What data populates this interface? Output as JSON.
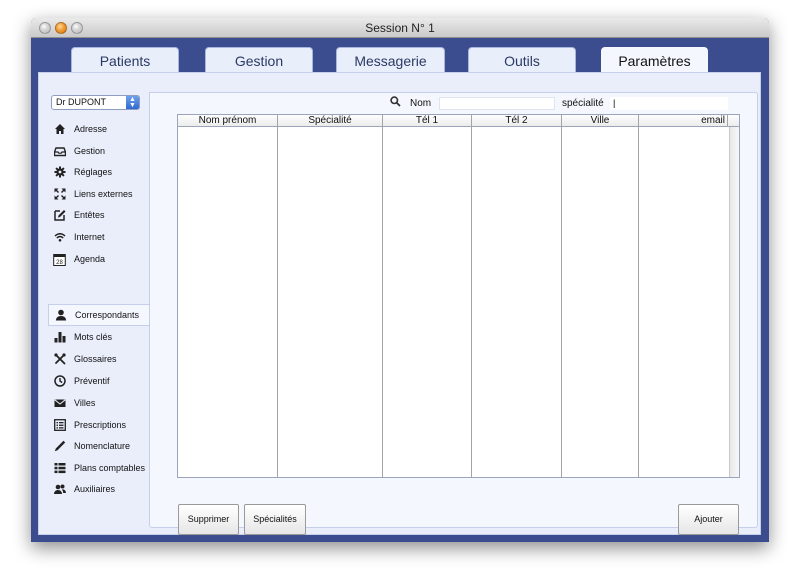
{
  "window": {
    "title": "Session N° 1"
  },
  "tabs": [
    {
      "label": "Patients",
      "active": false
    },
    {
      "label": "Gestion",
      "active": false
    },
    {
      "label": "Messagerie",
      "active": false
    },
    {
      "label": "Outils",
      "active": false
    },
    {
      "label": "Paramètres",
      "active": true
    }
  ],
  "sidebar": {
    "doctor_select": "Dr DUPONT",
    "top_items": [
      {
        "label": "Adresse",
        "icon": "home-icon"
      },
      {
        "label": "Gestion",
        "icon": "inbox-icon"
      },
      {
        "label": "Réglages",
        "icon": "gear-icon"
      },
      {
        "label": "Liens externes",
        "icon": "expand-icon"
      },
      {
        "label": "Entêtes",
        "icon": "edit-icon"
      },
      {
        "label": "Internet",
        "icon": "wifi-icon"
      },
      {
        "label": "Agenda",
        "icon": "calendar-icon",
        "badge": "28"
      }
    ],
    "bottom_items": [
      {
        "label": "Correspondants",
        "icon": "user-icon",
        "selected": true
      },
      {
        "label": "Mots clés",
        "icon": "bar-chart-icon"
      },
      {
        "label": "Glossaires",
        "icon": "tools-icon"
      },
      {
        "label": "Préventif",
        "icon": "clock-icon"
      },
      {
        "label": "Villes",
        "icon": "envelope-icon"
      },
      {
        "label": "Prescriptions",
        "icon": "list-box-icon"
      },
      {
        "label": "Nomenclature",
        "icon": "pencil-icon"
      },
      {
        "label": "Plans comptables",
        "icon": "list-icon"
      },
      {
        "label": "Auxiliaires",
        "icon": "users-icon"
      }
    ]
  },
  "search": {
    "nom_label": "Nom",
    "nom_value": "",
    "specialite_label": "spécialité",
    "specialite_value": "|"
  },
  "table": {
    "columns": [
      "Nom prénom",
      "Spécialité",
      "Tél 1",
      "Tél 2",
      "Ville",
      "email"
    ],
    "rows": []
  },
  "buttons": {
    "delete": "Supprimer",
    "specialties": "Spécialités",
    "add": "Ajouter"
  },
  "colors": {
    "window_frame": "#3b4d8e",
    "panel": "#e9eefa",
    "active_panel": "#f4f7fe"
  }
}
